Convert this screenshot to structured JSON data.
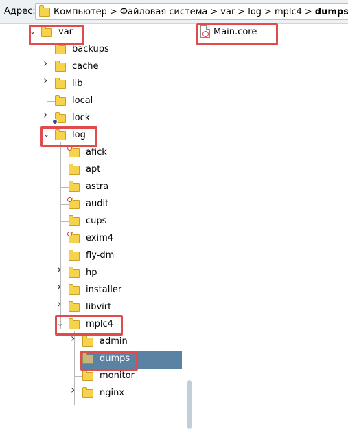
{
  "address_bar": {
    "label": "Адрес:",
    "path": [
      "Компьютер",
      "Файловая система",
      "var",
      "log",
      "mplc4",
      "dumps"
    ],
    "separator": ">"
  },
  "tree": {
    "items": [
      {
        "label": "var",
        "expander": "expanded",
        "emblem": "none"
      },
      {
        "label": "backups",
        "expander": "none",
        "emblem": "none"
      },
      {
        "label": "cache",
        "expander": "collapsed",
        "emblem": "none"
      },
      {
        "label": "lib",
        "expander": "collapsed",
        "emblem": "none"
      },
      {
        "label": "local",
        "expander": "none",
        "emblem": "none"
      },
      {
        "label": "lock",
        "expander": "collapsed",
        "emblem": "link"
      },
      {
        "label": "log",
        "expander": "expanded",
        "emblem": "none"
      },
      {
        "label": "afick",
        "expander": "none",
        "emblem": "restricted"
      },
      {
        "label": "apt",
        "expander": "none",
        "emblem": "none"
      },
      {
        "label": "astra",
        "expander": "none",
        "emblem": "none"
      },
      {
        "label": "audit",
        "expander": "none",
        "emblem": "restricted"
      },
      {
        "label": "cups",
        "expander": "none",
        "emblem": "none"
      },
      {
        "label": "exim4",
        "expander": "none",
        "emblem": "restricted"
      },
      {
        "label": "fly-dm",
        "expander": "none",
        "emblem": "none"
      },
      {
        "label": "hp",
        "expander": "collapsed",
        "emblem": "none"
      },
      {
        "label": "installer",
        "expander": "collapsed",
        "emblem": "none"
      },
      {
        "label": "libvirt",
        "expander": "collapsed",
        "emblem": "none"
      },
      {
        "label": "mplc4",
        "expander": "expanded",
        "emblem": "none"
      },
      {
        "label": "admin",
        "expander": "collapsed",
        "emblem": "none"
      },
      {
        "label": "dumps",
        "expander": "none",
        "emblem": "none",
        "selected": true
      },
      {
        "label": "monitor",
        "expander": "none",
        "emblem": "none"
      },
      {
        "label": "nginx",
        "expander": "collapsed",
        "emblem": "none"
      }
    ]
  },
  "files": [
    {
      "name": "Main.core",
      "icon": "core-file-icon"
    }
  ],
  "colors": {
    "selection": "#5a82a3",
    "highlight_box": "#e24b4b",
    "folder": "#f7d24d"
  }
}
